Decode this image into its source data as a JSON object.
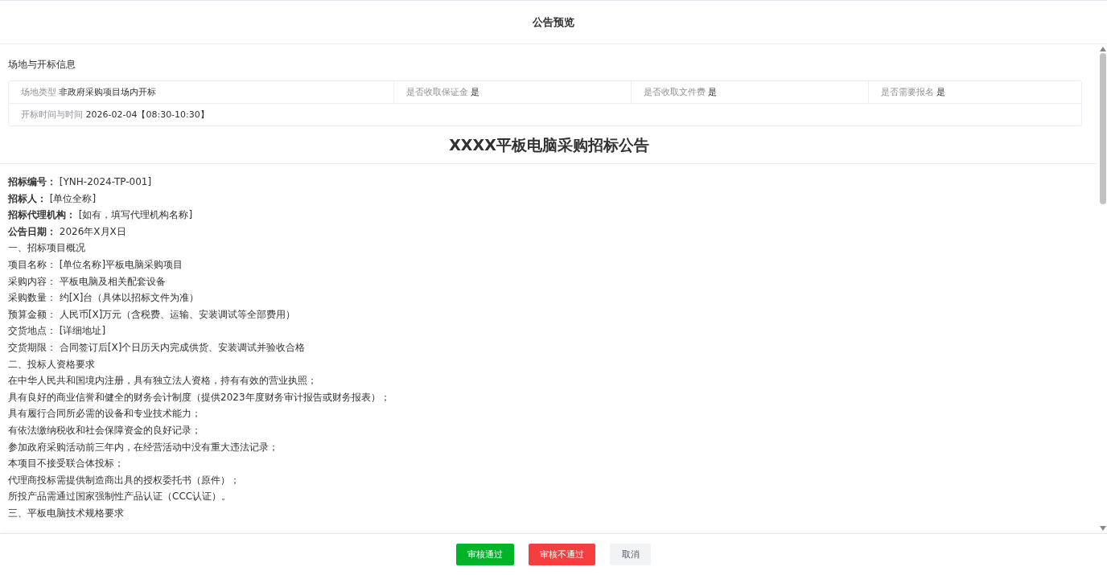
{
  "dialog": {
    "title": "公告预览"
  },
  "venue_info": {
    "heading": "场地与开标信息",
    "rows": [
      [
        {
          "label": "场地类型",
          "value": "非政府采购项目场内开标"
        },
        {
          "label": "是否收取保证金",
          "value": "是"
        },
        {
          "label": "是否收取文件费",
          "value": "是"
        },
        {
          "label": "是否需要报名",
          "value": "是"
        }
      ],
      [
        {
          "label": "开标时间与时间",
          "value": "2026-02-04【08:30-10:30】"
        }
      ]
    ]
  },
  "document": {
    "title": "XXXX平板电脑采购招标公告",
    "lines": [
      {
        "kind": "field",
        "label": "招标编号：",
        "value": "[YNH-2024-TP-001]"
      },
      {
        "kind": "field",
        "label": "招标人：",
        "value": "[单位全称]"
      },
      {
        "kind": "field",
        "label": "招标代理机构：",
        "value": "[如有，填写代理机构名称]"
      },
      {
        "kind": "field",
        "label": "公告日期：",
        "value": "2026年X月X日"
      },
      {
        "kind": "text",
        "text": "一、招标项目概况"
      },
      {
        "kind": "text",
        "text": "项目名称： [单位名称]平板电脑采购项目"
      },
      {
        "kind": "text",
        "text": "采购内容： 平板电脑及相关配套设备"
      },
      {
        "kind": "text",
        "text": "采购数量： 约[X]台（具体以招标文件为准）"
      },
      {
        "kind": "text",
        "text": "预算金额： 人民币[X]万元（含税费、运输、安装调试等全部费用）"
      },
      {
        "kind": "text",
        "text": "交货地点： [详细地址]"
      },
      {
        "kind": "text",
        "text": "交货期限： 合同签订后[X]个日历天内完成供货、安装调试并验收合格"
      },
      {
        "kind": "text",
        "text": "二、投标人资格要求"
      },
      {
        "kind": "text",
        "text": "在中华人民共和国境内注册，具有独立法人资格，持有有效的营业执照；"
      },
      {
        "kind": "text",
        "text": "具有良好的商业信誉和健全的财务会计制度（提供2023年度财务审计报告或财务报表）；"
      },
      {
        "kind": "text",
        "text": "具有履行合同所必需的设备和专业技术能力；"
      },
      {
        "kind": "text",
        "text": "有依法缴纳税收和社会保障资金的良好记录；"
      },
      {
        "kind": "text",
        "text": "参加政府采购活动前三年内，在经营活动中没有重大违法记录；"
      },
      {
        "kind": "text",
        "text": "本项目不接受联合体投标；"
      },
      {
        "kind": "text",
        "text": "代理商投标需提供制造商出具的授权委托书（原件）；"
      },
      {
        "kind": "text",
        "text": "所投产品需通过国家强制性产品认证（CCC认证）。"
      },
      {
        "kind": "text",
        "text": "三、平板电脑技术规格要求"
      }
    ]
  },
  "buttons": [
    {
      "kind": "approve",
      "label": "审核通过"
    },
    {
      "kind": "reject",
      "label": "审核不通过"
    },
    {
      "kind": "cancel",
      "label": "取消"
    }
  ]
}
